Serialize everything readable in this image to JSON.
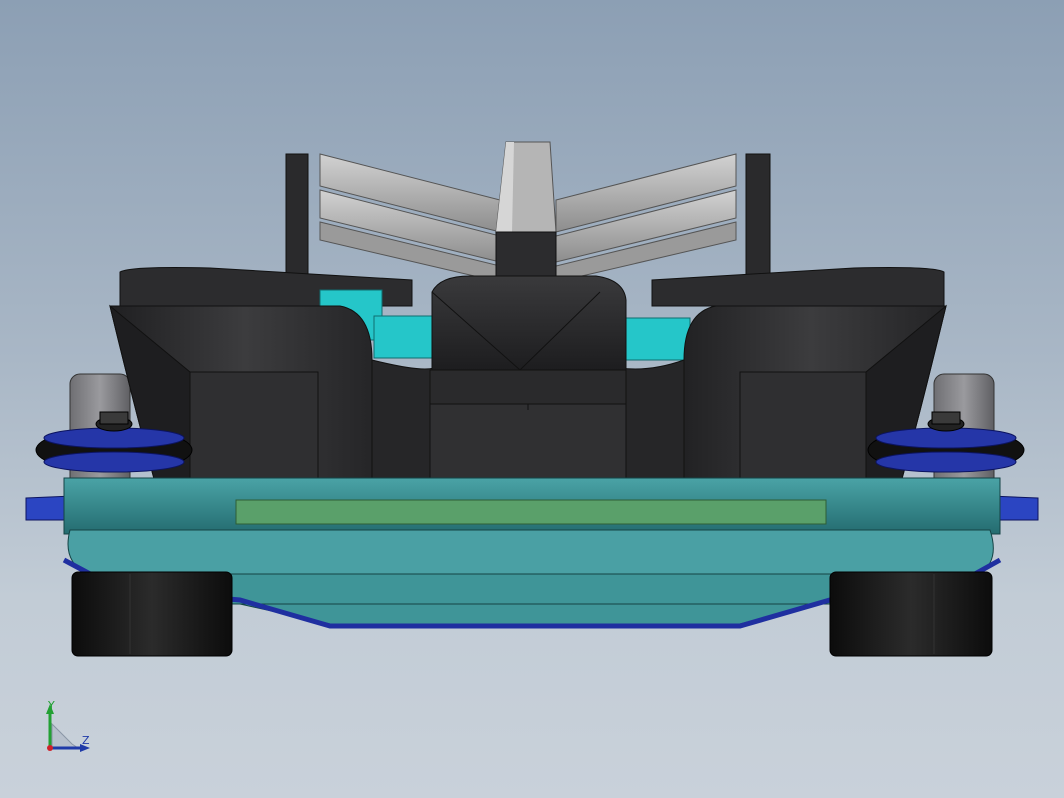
{
  "viewport": {
    "background_top": "#8c9fb4",
    "background_bottom": "#c9d1da"
  },
  "model": {
    "body_color": "#2b2b2d",
    "wing_color": "#a9a9a9",
    "chassis_color": "#2f8a8f",
    "accent_color": "#25c6c9",
    "bumper_color": "#1f2fa0",
    "tire_color": "#111111"
  },
  "triad": {
    "y_label": "Y",
    "z_label": "Z",
    "y_color": "#22a033",
    "z_color": "#1f3aa8",
    "origin_color": "#d0202a"
  }
}
